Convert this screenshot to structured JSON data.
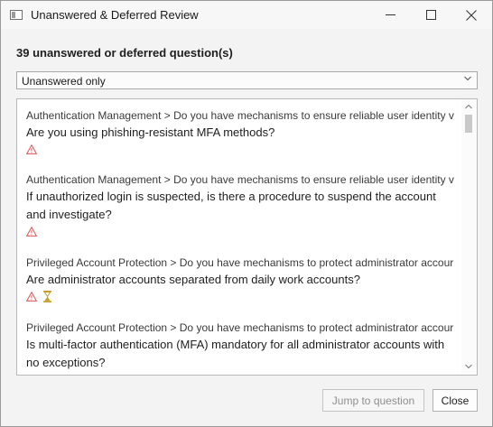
{
  "window": {
    "title": "Unanswered & Deferred Review"
  },
  "heading": "39 unanswered or deferred question(s)",
  "filter": {
    "selected": "Unanswered only"
  },
  "items": [
    {
      "path": "Authentication Management > Do you have mechanisms to ensure reliable user identity v",
      "question": "Are you using phishing-resistant MFA methods?",
      "flags": [
        "warning-icon"
      ]
    },
    {
      "path": "Authentication Management > Do you have mechanisms to ensure reliable user identity v",
      "question": "If unauthorized login is suspected, is there a procedure to suspend the account and investigate?",
      "flags": [
        "warning-icon"
      ]
    },
    {
      "path": "Privileged Account Protection > Do you have mechanisms to protect administrator accour",
      "question": "Are administrator accounts separated from daily work accounts?",
      "flags": [
        "warning-icon",
        "hourglass-icon"
      ]
    },
    {
      "path": "Privileged Account Protection > Do you have mechanisms to protect administrator accour",
      "question": "Is multi-factor authentication (MFA) mandatory for all administrator accounts with no exceptions?",
      "flags": []
    }
  ],
  "buttons": {
    "jump": "Jump to question",
    "close": "Close"
  },
  "colors": {
    "warning": "#e05050",
    "hourglass": "#c8a032",
    "disabled_text": "#8f8f8f"
  }
}
